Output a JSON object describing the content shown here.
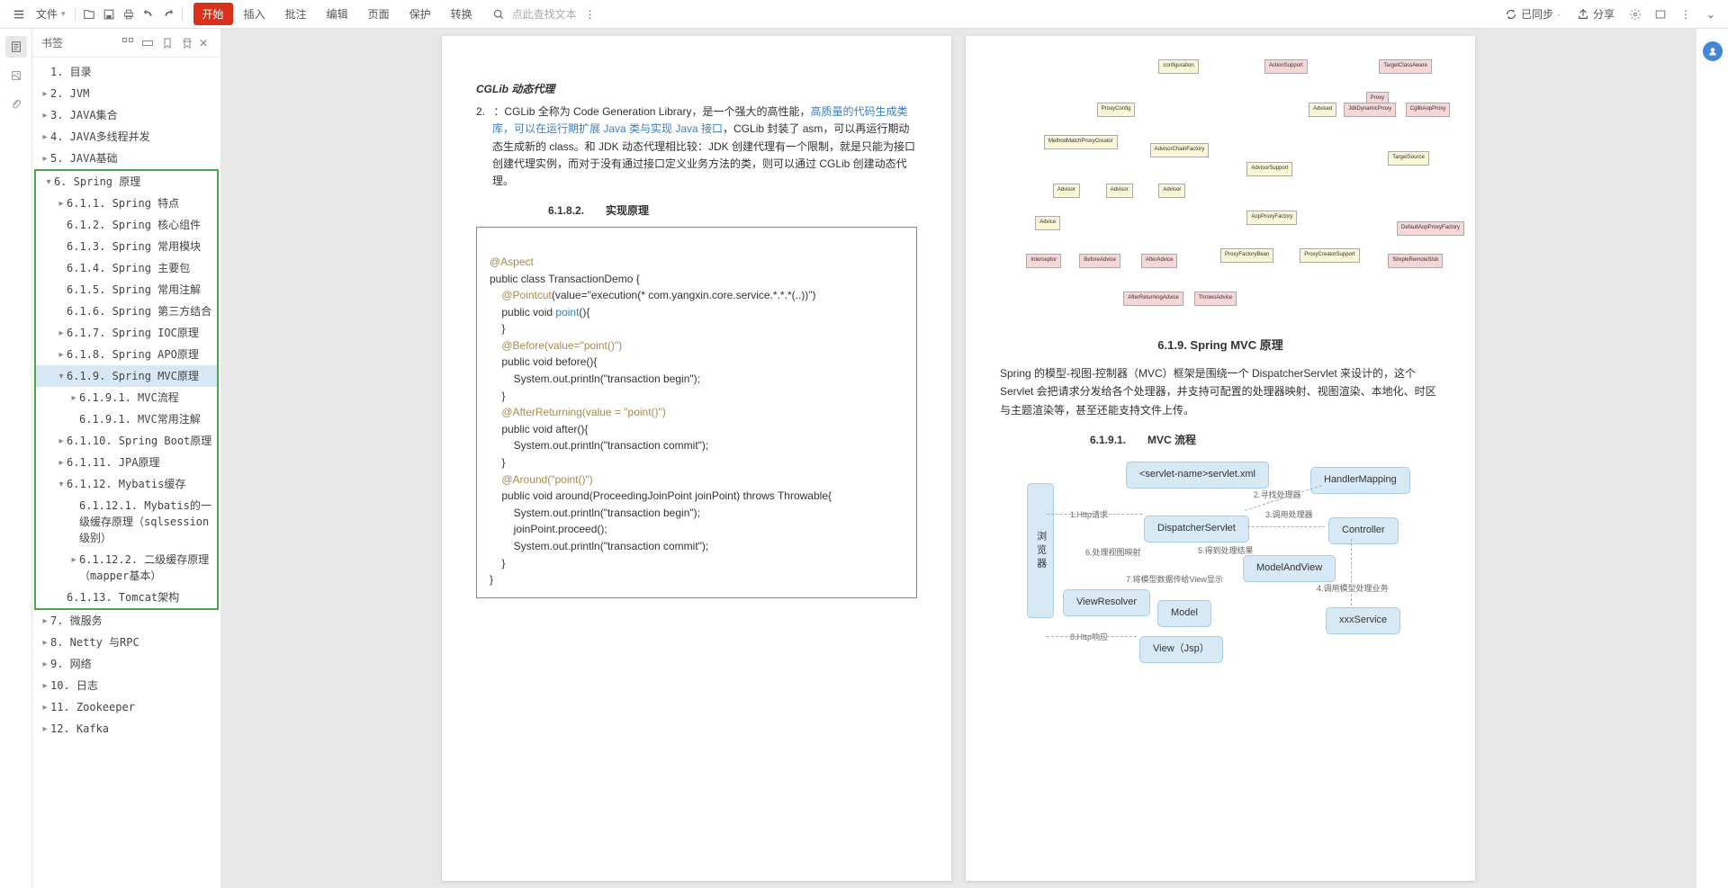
{
  "toolbar": {
    "file_menu": "文件",
    "tabs": [
      "开始",
      "插入",
      "批注",
      "编辑",
      "页面",
      "保护",
      "转换"
    ],
    "active_tab_index": 0,
    "search_placeholder": "点此查找文本",
    "sync_label": "已同步",
    "share_label": "分享"
  },
  "sidebar": {
    "title": "书签",
    "tree": [
      {
        "pad": 8,
        "chev": "",
        "label": "1. 目录"
      },
      {
        "pad": 8,
        "chev": "▸",
        "label": "2. JVM"
      },
      {
        "pad": 8,
        "chev": "▸",
        "label": "3. JAVA集合"
      },
      {
        "pad": 8,
        "chev": "▸",
        "label": "4. JAVA多线程并发"
      },
      {
        "pad": 8,
        "chev": "▸",
        "label": "5. JAVA基础"
      }
    ],
    "highlight_tree": [
      {
        "pad": 8,
        "chev": "▾",
        "label": "6. Spring 原理",
        "sel": false
      },
      {
        "pad": 22,
        "chev": "▸",
        "label": "6.1.1. Spring 特点",
        "sel": false
      },
      {
        "pad": 22,
        "chev": "",
        "label": "6.1.2. Spring 核心组件",
        "sel": false
      },
      {
        "pad": 22,
        "chev": "",
        "label": "6.1.3. Spring 常用模块",
        "sel": false
      },
      {
        "pad": 22,
        "chev": "",
        "label": "6.1.4. Spring 主要包",
        "sel": false
      },
      {
        "pad": 22,
        "chev": "",
        "label": "6.1.5. Spring 常用注解",
        "sel": false
      },
      {
        "pad": 22,
        "chev": "",
        "label": "6.1.6. Spring 第三方结合",
        "sel": false
      },
      {
        "pad": 22,
        "chev": "▸",
        "label": "6.1.7. Spring IOC原理",
        "sel": false
      },
      {
        "pad": 22,
        "chev": "▸",
        "label": "6.1.8. Spring APO原理",
        "sel": false
      },
      {
        "pad": 22,
        "chev": "▾",
        "label": "6.1.9. Spring MVC原理",
        "sel": true
      },
      {
        "pad": 36,
        "chev": "▸",
        "label": "6.1.9.1. MVC流程",
        "sel": false
      },
      {
        "pad": 36,
        "chev": "",
        "label": "6.1.9.1. MVC常用注解",
        "sel": false
      },
      {
        "pad": 22,
        "chev": "▸",
        "label": "6.1.10. Spring Boot原理",
        "sel": false
      },
      {
        "pad": 22,
        "chev": "▸",
        "label": "6.1.11. JPA原理",
        "sel": false
      },
      {
        "pad": 22,
        "chev": "▾",
        "label": "6.1.12. Mybatis缓存",
        "sel": false
      },
      {
        "pad": 36,
        "chev": "",
        "label": "6.1.12.1. Mybatis的一级缓存原理（sqlsession级别）",
        "sel": false
      },
      {
        "pad": 36,
        "chev": "▸",
        "label": "6.1.12.2. 二级缓存原理（mapper基本）",
        "sel": false
      },
      {
        "pad": 22,
        "chev": "",
        "label": "6.1.13. Tomcat架构",
        "sel": false
      }
    ],
    "tree_after": [
      {
        "pad": 8,
        "chev": "▸",
        "label": "7. 微服务"
      },
      {
        "pad": 8,
        "chev": "▸",
        "label": "8. Netty 与RPC"
      },
      {
        "pad": 8,
        "chev": "▸",
        "label": "9. 网络"
      },
      {
        "pad": 8,
        "chev": "▸",
        "label": "10. 日志"
      },
      {
        "pad": 8,
        "chev": "▸",
        "label": "11. Zookeeper"
      },
      {
        "pad": 8,
        "chev": "▸",
        "label": "12. Kafka"
      }
    ]
  },
  "page_left": {
    "cglib_title": "CGLib 动态代理",
    "para_num": "2.",
    "para_text_before": "：CGLib 全称为 Code Generation Library，是一个强大的高性能，",
    "para_link1": "高质量的代码生成类库，可以在运行期扩展 Java 类与实现 Java 接口",
    "para_text_after": "，CGLib 封装了 asm，可以再运行期动态生成新的 class。和 JDK 动态代理相比较：JDK 创建代理有一个限制，就是只能为接口创建代理实例，而对于没有通过接口定义业务方法的类，则可以通过 CGLib 创建动态代理。",
    "impl_heading": "6.1.8.2.　　实现原理",
    "code": {
      "l1": "@Aspect",
      "l2": "public class TransactionDemo {",
      "l3a": "    @Pointcut",
      "l3b": "(value=\"execution(* com.yangxin.core.service.*.*.*(..))\")",
      "l4a": "    public void ",
      "l4b": "point",
      "l4c": "(){",
      "l5": "    }",
      "l6": "    @Before(value=\"point()\")",
      "l7": "    public void before(){",
      "l8": "        System.out.println(\"transaction begin\");",
      "l9": "    }",
      "l10": "    @AfterReturning(value = \"point()\")",
      "l11": "    public void after(){",
      "l12": "        System.out.println(\"transaction commit\");",
      "l13": "    }",
      "l14": "    @Around(\"point()\")",
      "l15": "    public void around(ProceedingJoinPoint joinPoint) throws Throwable{",
      "l16": "        System.out.println(\"transaction begin\");",
      "l17": "        joinPoint.proceed();",
      "l18": "        System.out.println(\"transaction commit\");",
      "l19": "    }",
      "l20": "}"
    }
  },
  "page_right": {
    "mvc_heading": "6.1.9. Spring MVC 原理",
    "mvc_body": "Spring 的模型-视图-控制器（MVC）框架是围绕一个 DispatcherServlet 来设计的，这个 Servlet 会把请求分发给各个处理器，并支持可配置的处理器映射、视图渲染、本地化、时区与主题渲染等，甚至还能支持文件上传。",
    "mvc_flow_heading": "6.1.9.1.　　MVC 流程",
    "mvc_nodes": {
      "servlet_xml": "<servlet-name>servlet.xml",
      "handler_mapping": "HandlerMapping",
      "dispatcher": "DispatcherServlet",
      "controller": "Controller",
      "model_and_view": "ModelAndView",
      "view_resolver": "ViewResolver",
      "model": "Model",
      "xxx_service": "xxxService",
      "view_jsp": "View（Jsp）",
      "browser": "浏览器"
    },
    "mvc_labels": {
      "l1": "1.Http请求",
      "l2": "2.寻找处理器",
      "l3": "3.调用处理器",
      "l4": "4.调用模型处理业务",
      "l5": "5.得到处理结果",
      "l6": "6.处理视图映射",
      "l7": "7.将模型数据传给View显示",
      "l8": "8.Http响应"
    }
  }
}
